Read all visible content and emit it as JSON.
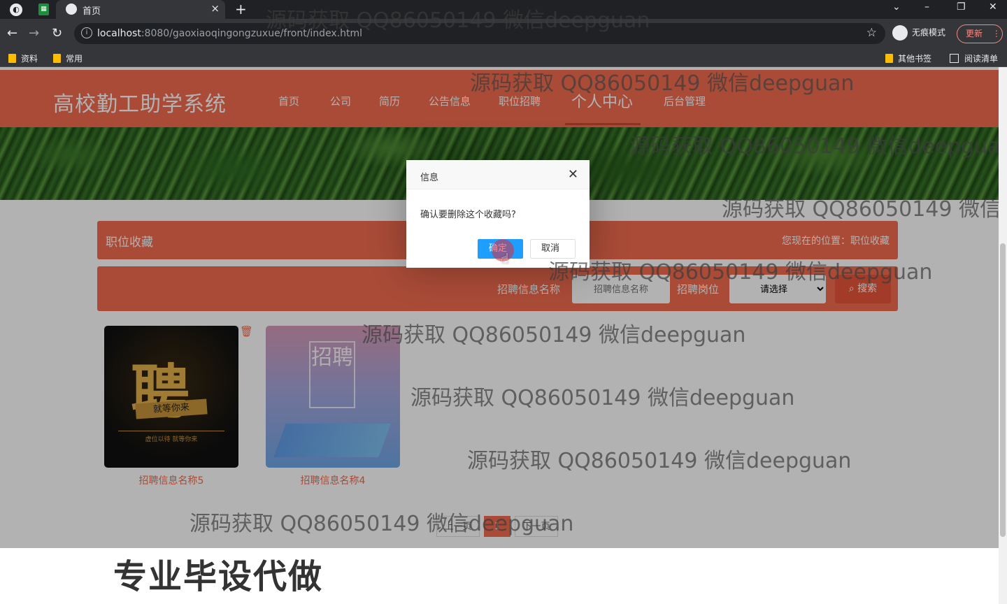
{
  "browser": {
    "tab_title": "首页",
    "url_host": "localhost",
    "url_rest": ":8080/gaoxiaoqingongzuxue/front/index.html",
    "incognito_label": "无痕模式",
    "update_label": "更新",
    "bookmarks": [
      "资料",
      "常用"
    ],
    "bookmarks_right": [
      "其他书签",
      "阅读清单"
    ]
  },
  "site": {
    "logo": "高校勤工助学系统",
    "nav": [
      "首页",
      "公司",
      "简历",
      "公告信息",
      "职位招聘",
      "个人中心",
      "后台管理"
    ],
    "active_nav": "个人中心"
  },
  "section": {
    "title": "职位收藏",
    "breadcrumb": "您现在的位置：职位收藏"
  },
  "search": {
    "name_label": "招聘信息名称",
    "name_placeholder": "招聘信息名称",
    "position_label": "招聘岗位",
    "position_option": "请选择",
    "button": "搜索"
  },
  "cards": [
    {
      "caption": "招聘信息名称5",
      "poster_big": "聘",
      "poster_ribbon": "就等你来",
      "poster_line": "虚位以待 就等你来"
    },
    {
      "caption": "招聘信息名称4",
      "poster_frame": "招聘"
    }
  ],
  "pagination": {
    "prev": "上一页",
    "current": "1",
    "next": "下一页"
  },
  "dialog": {
    "title": "信息",
    "message": "确认要删除这个收藏吗?",
    "ok": "确定",
    "cancel": "取消"
  },
  "watermark": {
    "text": "源码获取 QQ86050149 微信deepguan",
    "bottom_text": "专业毕设代做"
  },
  "colors": {
    "accent": "#f26c4f",
    "dialog_ok": "#1e9fff"
  }
}
